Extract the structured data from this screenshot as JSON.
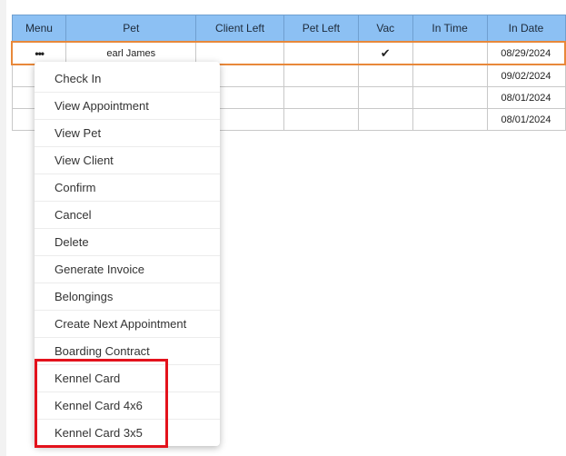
{
  "table": {
    "headers": [
      "Menu",
      "Pet",
      "Client Left",
      "Pet Left",
      "Vac",
      "In Time",
      "In Date"
    ],
    "rows": [
      {
        "menu": "•••",
        "pet": "earl James",
        "client_left": "",
        "pet_left": "",
        "vac": "✔",
        "in_time": "",
        "in_date": "08/29/2024"
      },
      {
        "menu": "",
        "pet": "",
        "client_left": "",
        "pet_left": "",
        "vac": "",
        "in_time": "",
        "in_date": "09/02/2024"
      },
      {
        "menu": "",
        "pet": "",
        "client_left": "",
        "pet_left": "",
        "vac": "",
        "in_time": "",
        "in_date": "08/01/2024"
      },
      {
        "menu": "",
        "pet": "",
        "client_left": "",
        "pet_left": "",
        "vac": "",
        "in_time": "",
        "in_date": "08/01/2024"
      }
    ]
  },
  "context_menu": {
    "items": [
      "Check In",
      "View Appointment",
      "View Pet",
      "View Client",
      "Confirm",
      "Cancel",
      "Delete",
      "Generate Invoice",
      "Belongings",
      "Create Next Appointment",
      "Boarding Contract",
      "Kennel Card",
      "Kennel Card 4x6",
      "Kennel Card 3x5"
    ]
  },
  "colors": {
    "header_bg": "#8cc0f3",
    "selected_row_border": "#e8883a",
    "highlight_box": "#e3121c"
  },
  "icons": {
    "row_menu": "more-dots-icon",
    "vaccinated": "checkmark-icon"
  }
}
